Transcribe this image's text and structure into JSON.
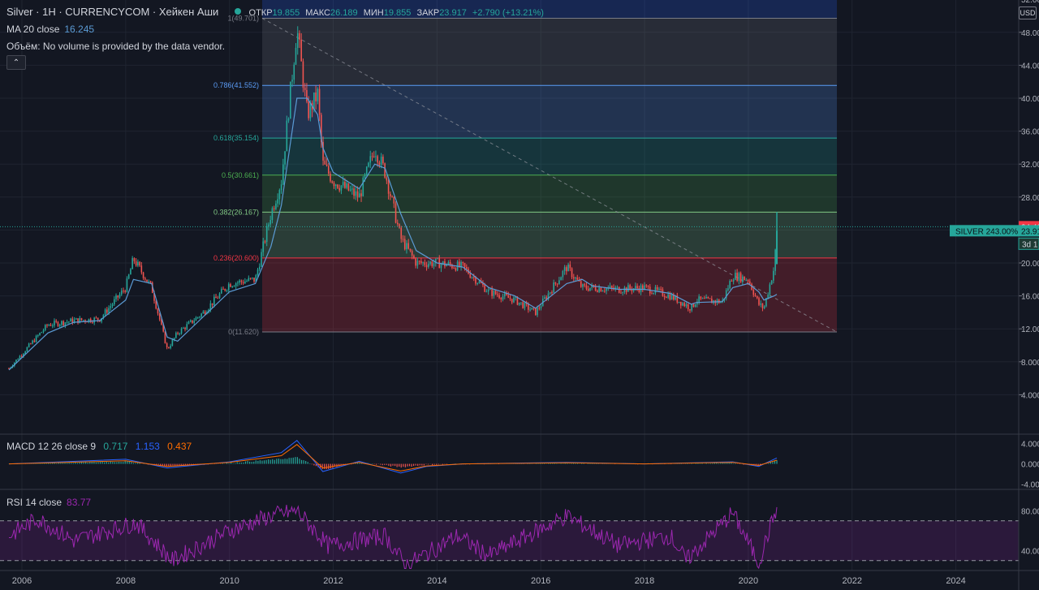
{
  "header": {
    "symbol": "Silver",
    "interval": "1H",
    "exchange": "CURRENCYCOM",
    "chart_type": "Хейкен Аши",
    "open_label": "ОТКР",
    "open_value": "19.855",
    "high_label": "МАКС",
    "high_value": "26.189",
    "low_label": "МИН",
    "low_value": "19.855",
    "close_label": "ЗАКР",
    "close_value": "23.917",
    "change": "+2.790 (+13.21%)"
  },
  "indicators": {
    "ma_label": "MA 20 close",
    "ma_value": "16.245",
    "volume_label": "Объём: No volume is provided by the data vendor.",
    "collapse_icon": "chevron-up-icon",
    "macd_label": "MACD 12 26 close 9",
    "macd_values": [
      "0.717",
      "1.153",
      "0.437"
    ],
    "rsi_label": "RSI 14 close",
    "rsi_value": "83.77"
  },
  "currency_button": "USD",
  "price_axis": {
    "ticks": [
      "52.00",
      "48.00",
      "44.00",
      "40.00",
      "36.00",
      "32.00",
      "28.00",
      "24.00",
      "20.00",
      "16.00",
      "12.00",
      "8.000",
      "4.000"
    ],
    "price_tag": "24.40",
    "last_price_tag": "23.91",
    "series_tag": "SILVER 243.00%",
    "countdown_tag": "3d 1"
  },
  "macd_axis": [
    "4.000",
    "0.000",
    "-4.000"
  ],
  "rsi_axis": [
    "80.00",
    "40.00"
  ],
  "time_axis": [
    "2006",
    "2008",
    "2010",
    "2012",
    "2014",
    "2016",
    "2018",
    "2020",
    "2022",
    "2024"
  ],
  "fib_levels": [
    {
      "label": "1(49.701)",
      "price": 49.701,
      "color": "#787b86"
    },
    {
      "label": "0.786(41.552)",
      "price": 41.552,
      "color": "#5b9cf6"
    },
    {
      "label": "0.618(35.154)",
      "price": 35.154,
      "color": "#26a69a"
    },
    {
      "label": "0.5(30.661)",
      "price": 30.661,
      "color": "#4caf50"
    },
    {
      "label": "0.382(26.167)",
      "price": 26.167,
      "color": "#81c784"
    },
    {
      "label": "0.236(20.600)",
      "price": 20.6,
      "color": "#f23645"
    },
    {
      "label": "0(11.620)",
      "price": 11.62,
      "color": "#787b86"
    }
  ],
  "colors": {
    "background": "#131722",
    "up": "#26a69a",
    "down": "#ef5350",
    "ma": "#5b9bd5",
    "macd_line": "#2962ff",
    "signal_line": "#ff6d00",
    "rsi": "#9c27b0",
    "last_price": "#26a69a",
    "price_tag": "#f23645"
  },
  "chart_data": {
    "type": "line",
    "title": "",
    "xlabel": "",
    "ylabel": "",
    "ylim": [
      3.5,
      54
    ],
    "x": [
      2005.75,
      2006.5,
      2007.0,
      2007.5,
      2008.0,
      2008.15,
      2008.5,
      2008.8,
      2009.0,
      2009.5,
      2010.0,
      2010.5,
      2010.8,
      2011.0,
      2011.3,
      2011.5,
      2011.7,
      2011.8,
      2012.0,
      2012.5,
      2012.8,
      2013.0,
      2013.3,
      2013.6,
      2014.0,
      2014.5,
      2015.0,
      2015.5,
      2015.9,
      2016.5,
      2016.8,
      2017.0,
      2017.5,
      2018.0,
      2018.5,
      2018.9,
      2019.0,
      2019.5,
      2019.7,
      2020.0,
      2020.2,
      2020.3,
      2020.5,
      2020.55
    ],
    "series": [
      {
        "values": [
          7.2,
          12.5,
          13.0,
          13.2,
          17.0,
          20.5,
          17.0,
          9.5,
          11.5,
          14.0,
          17.5,
          18.0,
          26.0,
          30.0,
          48.5,
          38.0,
          40.5,
          32.0,
          30.0,
          28.0,
          34.0,
          31.0,
          23.0,
          20.0,
          20.0,
          19.5,
          16.5,
          15.5,
          14.0,
          19.5,
          17.0,
          17.0,
          16.8,
          17.0,
          16.0,
          14.5,
          15.5,
          15.3,
          18.5,
          18.0,
          15.0,
          14.5,
          19.5,
          23.9
        ]
      }
    ],
    "ma_series": {
      "values": [
        7.0,
        11.5,
        12.8,
        13.0,
        15.5,
        18.0,
        17.5,
        11.0,
        10.5,
        13.5,
        16.5,
        17.5,
        22.0,
        27.0,
        40.0,
        40.0,
        38.0,
        34.0,
        31.0,
        29.0,
        32.0,
        31.5,
        26.0,
        21.5,
        20.0,
        19.5,
        17.0,
        16.0,
        14.5,
        17.5,
        18.0,
        17.2,
        16.8,
        16.8,
        16.3,
        15.0,
        15.2,
        15.3,
        17.0,
        17.5,
        16.5,
        15.5,
        16.0,
        16.2
      ]
    },
    "macd": {
      "ylim": [
        -5,
        5.5
      ],
      "x": [
        2005.75,
        2008.0,
        2008.8,
        2010.0,
        2011.0,
        2011.3,
        2011.8,
        2012.5,
        2013.3,
        2013.8,
        2014.5,
        2016.5,
        2018.0,
        2019.7,
        2020.2,
        2020.55
      ],
      "line": [
        0,
        0.9,
        -0.8,
        0.4,
        2.2,
        4.6,
        -1.5,
        0.5,
        -1.8,
        -0.5,
        0,
        0.3,
        0,
        0.4,
        -0.5,
        1.15
      ],
      "signal": [
        0,
        0.6,
        -0.5,
        0.3,
        1.6,
        3.8,
        -0.8,
        0.3,
        -1.4,
        -0.4,
        0,
        0.2,
        0,
        0.3,
        -0.3,
        0.72
      ]
    },
    "rsi": {
      "ylim": [
        20,
        100
      ],
      "band": [
        30,
        70
      ],
      "x": [
        2005.75,
        2006.3,
        2007.0,
        2008.2,
        2008.9,
        2010.0,
        2010.8,
        2011.3,
        2011.9,
        2013.0,
        2013.4,
        2014.4,
        2015.0,
        2016.5,
        2017.5,
        2018.5,
        2018.8,
        2019.7,
        2020.2,
        2020.55
      ],
      "values": [
        55,
        72,
        50,
        68,
        30,
        60,
        75,
        80,
        45,
        55,
        25,
        55,
        35,
        75,
        45,
        55,
        30,
        78,
        28,
        83.77
      ]
    }
  }
}
